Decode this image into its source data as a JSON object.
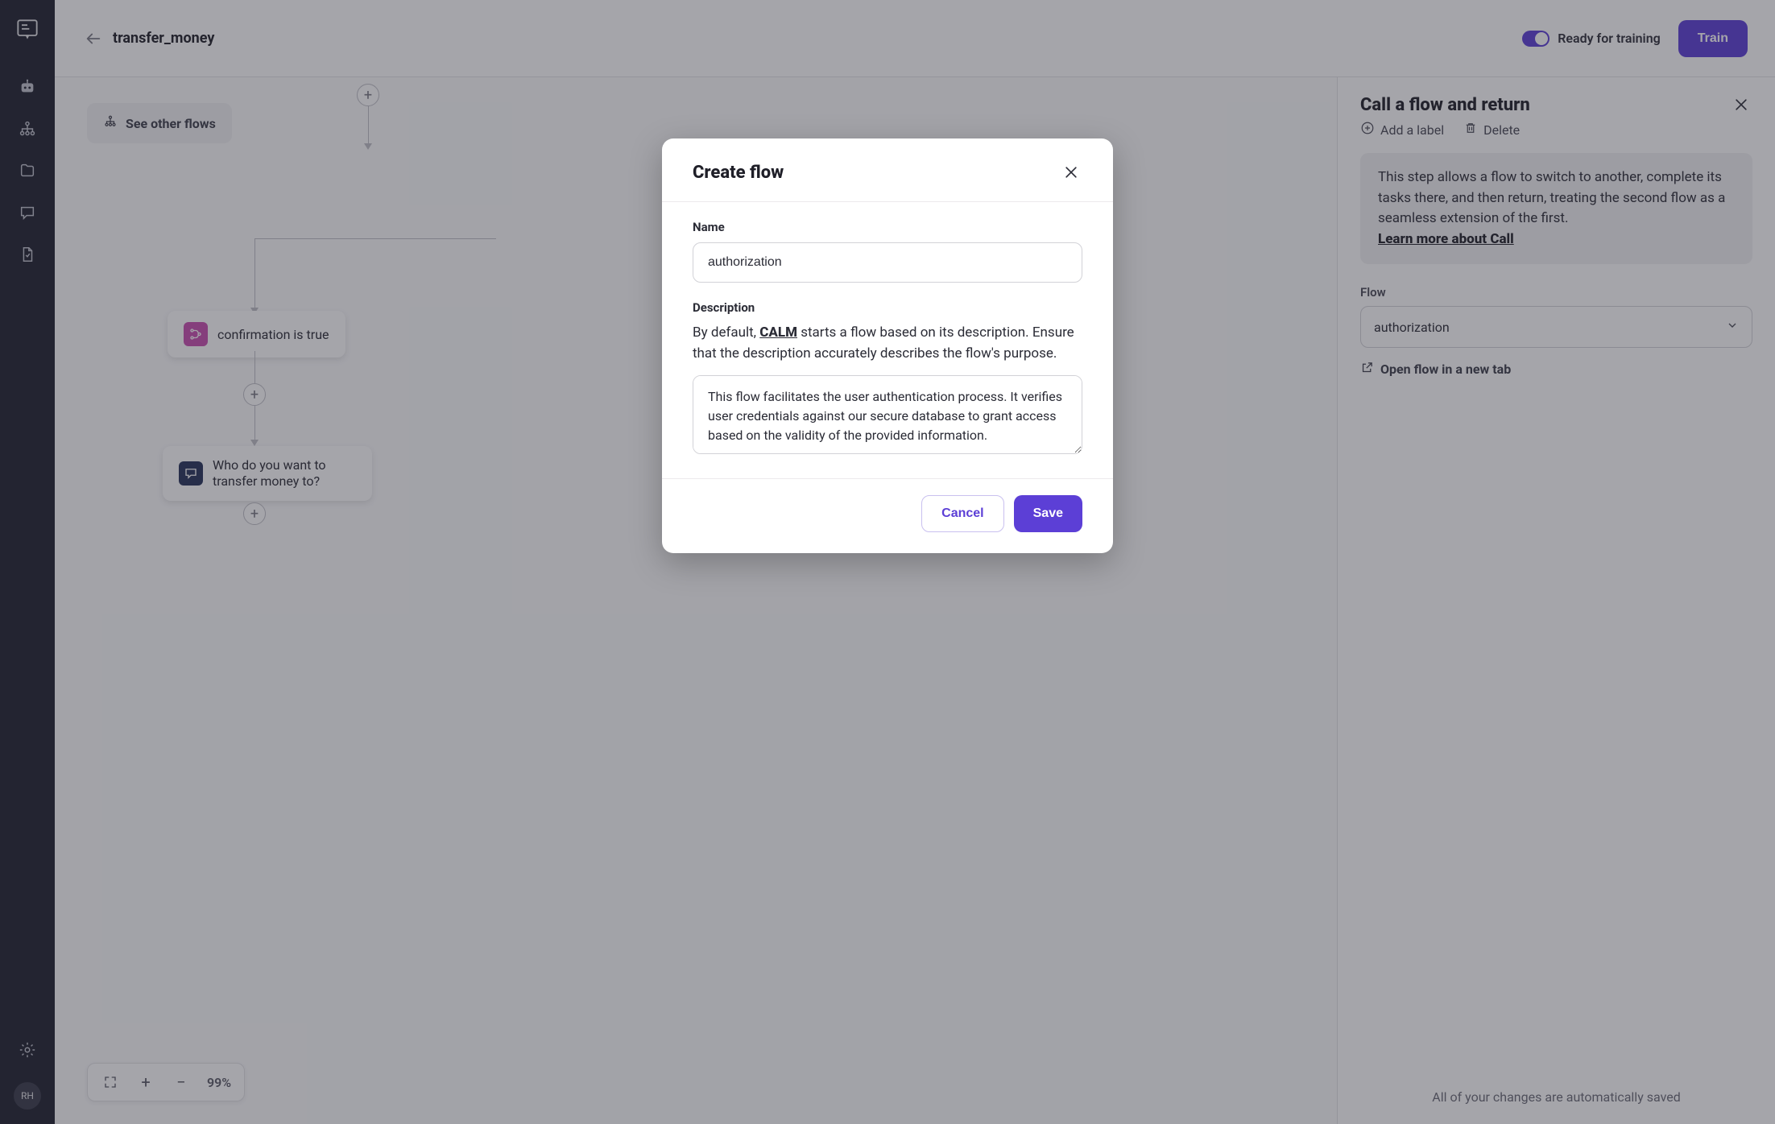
{
  "sidebar": {
    "avatar_initials": "RH"
  },
  "header": {
    "title": "transfer_money",
    "ready_label": "Ready for training",
    "train_label": "Train"
  },
  "canvas": {
    "see_other_label": "See other flows",
    "nodes": {
      "confirmation": "confirmation is true",
      "recipient_question": "Who do you want to transfer money to?"
    },
    "zoom_value": "99%"
  },
  "details": {
    "title": "Call a flow and return",
    "add_label": "Add a label",
    "delete": "Delete",
    "explain_text": "This step allows a flow to switch to another, complete its tasks there, and then return, treating the second flow as a seamless extension of the first.",
    "learn_more": "Learn more about Call",
    "flow_label": "Flow",
    "flow_value": "authorization",
    "open_in_new_tab": "Open flow in a new tab",
    "autosave": "All of your changes are automatically saved"
  },
  "modal": {
    "title": "Create flow",
    "name_label": "Name",
    "name_value": "authorization",
    "desc_label": "Description",
    "desc_preamble_before": "By default, ",
    "desc_preamble_link": "CALM",
    "desc_preamble_after": " starts a flow based on its description. Ensure that the description accurately describes the flow's purpose.",
    "desc_value": "This flow facilitates the user authentication process. It verifies user credentials against our secure database to grant access based on the validity of the provided information.",
    "cancel": "Cancel",
    "save": "Save"
  }
}
